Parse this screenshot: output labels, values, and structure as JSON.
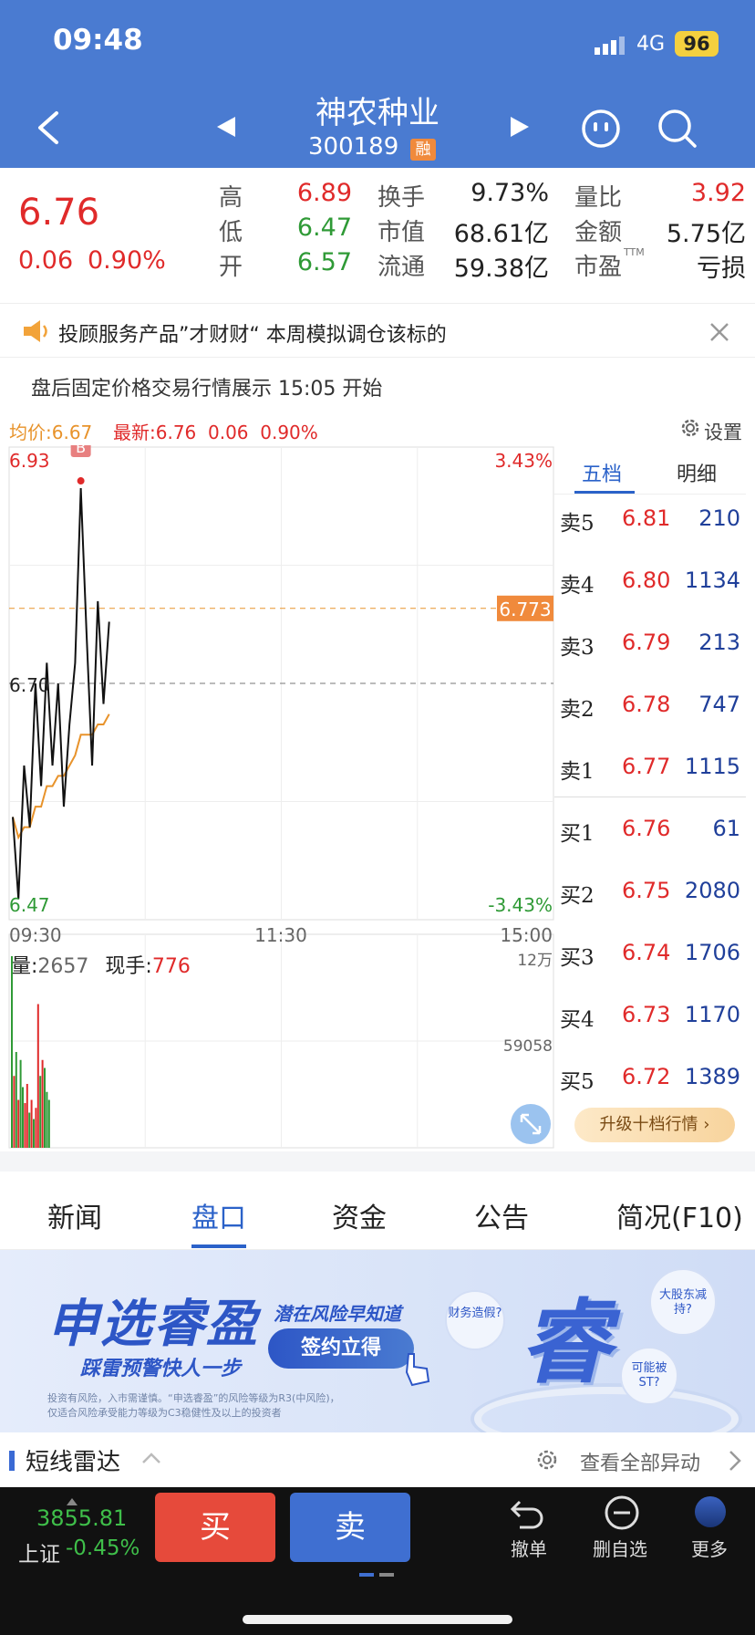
{
  "status_bar": {
    "time": "09:48",
    "network": "4G",
    "battery": "96"
  },
  "header": {
    "title": "神农种业",
    "code": "300189",
    "margin_badge": "融"
  },
  "quote": {
    "price": "6.76",
    "change": "0.06",
    "change_pct": "0.90%",
    "stats": [
      [
        {
          "label": "高",
          "value": "6.89",
          "color": "red"
        },
        {
          "label": "换手",
          "value": "9.73%",
          "color": "dark"
        },
        {
          "label": "量比",
          "value": "3.92",
          "color": "red"
        }
      ],
      [
        {
          "label": "低",
          "value": "6.47",
          "color": "green"
        },
        {
          "label": "市值",
          "value": "68.61亿",
          "color": "dark"
        },
        {
          "label": "金额",
          "value": "5.75亿",
          "color": "dark"
        }
      ],
      [
        {
          "label": "开",
          "value": "6.57",
          "color": "green"
        },
        {
          "label": "流通",
          "value": "59.38亿",
          "color": "dark"
        },
        {
          "label": "市盈",
          "value": "亏损",
          "color": "dark",
          "sup": "TTM"
        }
      ]
    ]
  },
  "notice": {
    "text": "投顾服务产品”才财财“ 本周模拟调仓该标的"
  },
  "after_trade": {
    "text": "盘后固定价格交易行情展示 15:05 开始"
  },
  "chart_header": {
    "avg_label": "均价:",
    "avg_value": "6.67",
    "latest_label": "最新:",
    "latest_value": "6.76",
    "latest_change": "0.06",
    "latest_pct": "0.90%",
    "settings": "设置"
  },
  "chart_data": {
    "type": "line",
    "y_high": "6.93",
    "y_low": "6.47",
    "pct_high": "3.43%",
    "pct_low": "-3.43%",
    "pre_close_label": "6.70",
    "current_tag": "6.773",
    "ylim": [
      6.47,
      6.93
    ],
    "pre_close": 6.7,
    "current_avg_ref": 6.773,
    "time_labels": [
      "09:30",
      "11:30",
      "15:00"
    ],
    "price": [
      6.57,
      6.49,
      6.62,
      6.56,
      6.7,
      6.6,
      6.72,
      6.62,
      6.7,
      6.58,
      6.66,
      6.72,
      6.89,
      6.75,
      6.62,
      6.78,
      6.68,
      6.76
    ],
    "avg": [
      6.57,
      6.55,
      6.56,
      6.56,
      6.58,
      6.58,
      6.6,
      6.6,
      6.61,
      6.61,
      6.62,
      6.63,
      6.65,
      6.65,
      6.65,
      6.66,
      6.66,
      6.67
    ],
    "b_marker_index": 12,
    "b_marker_label": "B",
    "volume": {
      "vol_label": "量:",
      "vol_value": "2657",
      "hand_label": "现手:",
      "hand_value": "776",
      "max_label": "12万",
      "mid_label": "59058",
      "bars": [
        {
          "v": 120000,
          "c": "green"
        },
        {
          "v": 45000,
          "c": "red"
        },
        {
          "v": 60000,
          "c": "green"
        },
        {
          "v": 30000,
          "c": "red"
        },
        {
          "v": 55000,
          "c": "green"
        },
        {
          "v": 38000,
          "c": "green"
        },
        {
          "v": 28000,
          "c": "red"
        },
        {
          "v": 40000,
          "c": "red"
        },
        {
          "v": 22000,
          "c": "green"
        },
        {
          "v": 30000,
          "c": "red"
        },
        {
          "v": 18000,
          "c": "green"
        },
        {
          "v": 25000,
          "c": "red"
        },
        {
          "v": 90000,
          "c": "red"
        },
        {
          "v": 45000,
          "c": "green"
        },
        {
          "v": 55000,
          "c": "red"
        },
        {
          "v": 50000,
          "c": "green"
        },
        {
          "v": 35000,
          "c": "green"
        },
        {
          "v": 30000,
          "c": "green"
        }
      ]
    }
  },
  "order_book": {
    "tabs": [
      "五档",
      "明细"
    ],
    "sell": [
      {
        "label": "卖5",
        "price": "6.81",
        "vol": "210"
      },
      {
        "label": "卖4",
        "price": "6.80",
        "vol": "1134"
      },
      {
        "label": "卖3",
        "price": "6.79",
        "vol": "213"
      },
      {
        "label": "卖2",
        "price": "6.78",
        "vol": "747"
      },
      {
        "label": "卖1",
        "price": "6.77",
        "vol": "1115"
      }
    ],
    "buy": [
      {
        "label": "买1",
        "price": "6.76",
        "vol": "61"
      },
      {
        "label": "买2",
        "price": "6.75",
        "vol": "2080"
      },
      {
        "label": "买3",
        "price": "6.74",
        "vol": "1706"
      },
      {
        "label": "买4",
        "price": "6.73",
        "vol": "1170"
      },
      {
        "label": "买5",
        "price": "6.72",
        "vol": "1389"
      }
    ],
    "upgrade": "升级十档行情"
  },
  "info_tabs": [
    "新闻",
    "盘口",
    "资金",
    "公告",
    "简况(F10)"
  ],
  "banner": {
    "title": "申选睿盈",
    "slogan": "踩雷预警快人一步",
    "subtitle": "潜在风险早知道",
    "cta": "签约立得",
    "bubbles": [
      "财务造假?",
      "大股东减持?",
      "可能被ST?"
    ],
    "big_char": "睿",
    "disclaimer1": "投资有风险，入市需谨慎。“申选睿盈”的风险等级为R3(中风险)，",
    "disclaimer2": "仅适合风险承受能力等级为C3稳健性及以上的投资者"
  },
  "radar": {
    "title": "短线雷达",
    "view_all": "查看全部异动"
  },
  "bottom": {
    "index_value": "3855.81",
    "index_name": "上证",
    "index_pct": "-0.45%",
    "buy": "买",
    "sell": "卖",
    "actions": [
      {
        "label": "撤单",
        "icon": "undo-icon"
      },
      {
        "label": "删自选",
        "icon": "minus-circle-icon"
      },
      {
        "label": "更多",
        "icon": "more-icon"
      }
    ]
  },
  "colors": {
    "header_blue": "#4a7bd1",
    "up_red": "#e02a2a",
    "down_green": "#2f9a36",
    "avg_orange": "#e8932b",
    "buy_btn": "#e64a3b",
    "sell_btn": "#3f6fd1"
  }
}
